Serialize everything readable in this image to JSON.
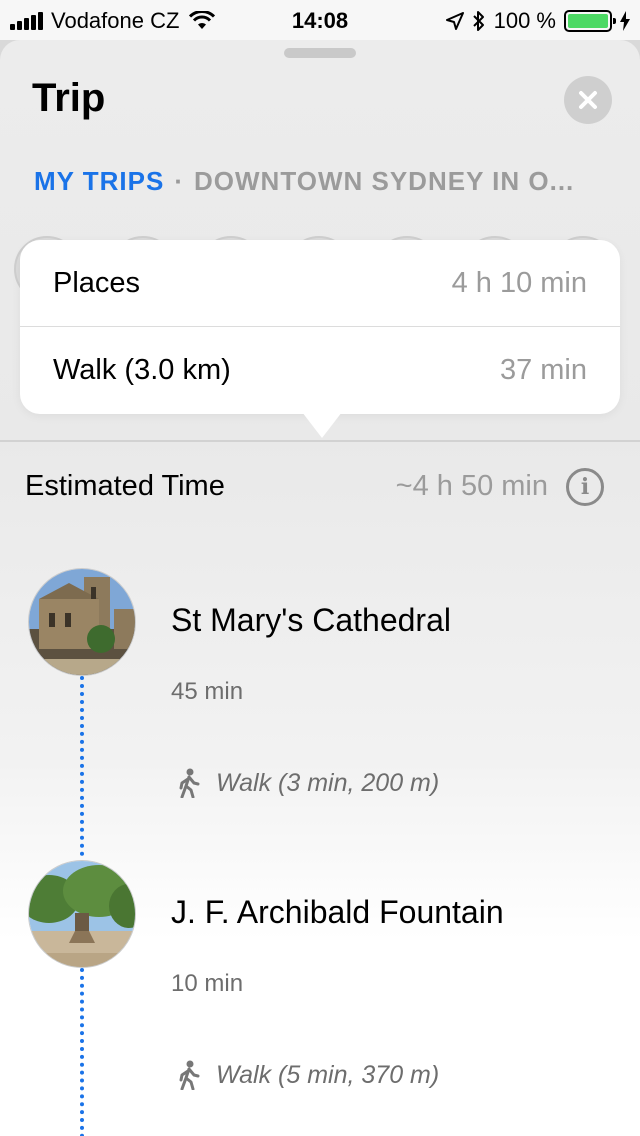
{
  "status_bar": {
    "carrier": "Vodafone CZ",
    "time": "14:08",
    "battery_percent": "100 %",
    "battery_level": 1.0,
    "icons": [
      "signal-icon",
      "wifi-icon",
      "location-arrow-icon",
      "bluetooth-icon",
      "battery-icon",
      "charging-bolt-icon"
    ]
  },
  "sheet": {
    "title": "Trip",
    "close_icon": "close-icon"
  },
  "breadcrumb": {
    "link": "MY TRIPS",
    "separator": "·",
    "current": "DOWNTOWN SYDNEY IN O..."
  },
  "popover": {
    "rows": [
      {
        "label": "Places",
        "value": "4 h 10 min"
      },
      {
        "label": "Walk (3.0 km)",
        "value": "37 min"
      }
    ]
  },
  "estimate": {
    "label": "Estimated Time",
    "value": "~4 h 50 min",
    "icon": "info-icon"
  },
  "stops": [
    {
      "name": "St Mary's Cathedral",
      "duration": "45 min",
      "walk": "Walk (3 min, 200 m)",
      "walk_icon": "walking-person-icon"
    },
    {
      "name": "J. F. Archibald Fountain",
      "duration": "10 min",
      "walk": "Walk (5 min, 370 m)",
      "walk_icon": "walking-person-icon"
    }
  ],
  "colors": {
    "accent": "#1a73e8",
    "secondary_text": "#9b9b9b",
    "battery": "#4cd964"
  }
}
